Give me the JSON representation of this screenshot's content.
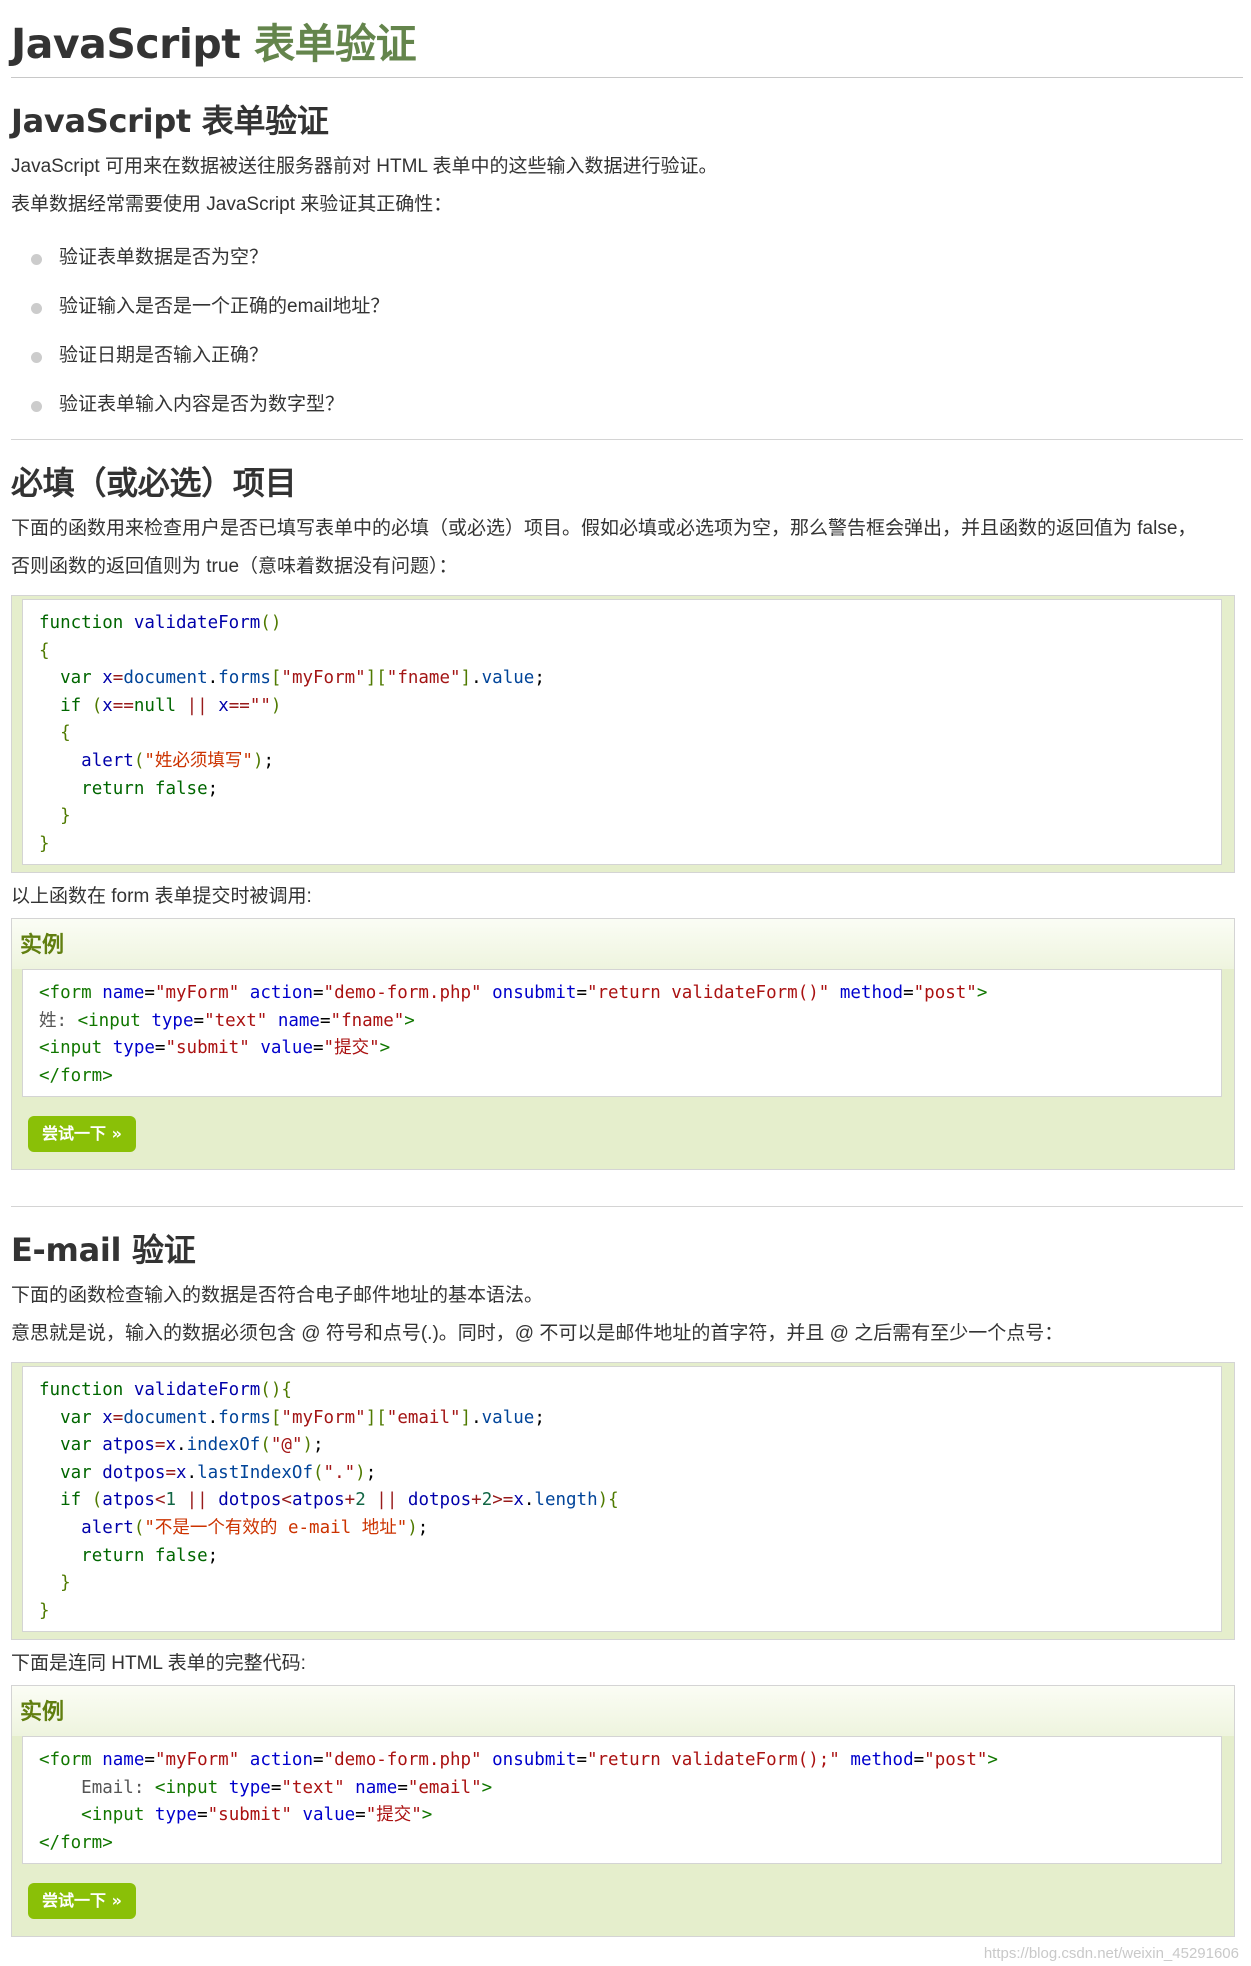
{
  "page": {
    "title_part1": "JavaScript",
    "title_part2": "表单验证",
    "watermark": "https://blog.csdn.net/weixin_45291606"
  },
  "section1": {
    "heading": "JavaScript 表单验证",
    "para1": "JavaScript 可用来在数据被送往服务器前对 HTML 表单中的这些输入数据进行验证。",
    "para2": "表单数据经常需要使用 JavaScript 来验证其正确性：",
    "bullets": [
      "验证表单数据是否为空？",
      "验证输入是否是一个正确的email地址？",
      "验证日期是否输入正确？",
      "验证表单输入内容是否为数字型？"
    ]
  },
  "section2": {
    "heading": "必填（或必选）项目",
    "para1": "下面的函数用来检查用户是否已填写表单中的必填（或必选）项目。假如必填或必选项为空，那么警告框会弹出，并且函数的返回值为 false，",
    "para2": "否则函数的返回值则为 true（意味着数据没有问题）：",
    "after_code": "以上函数在 form 表单提交时被调用:",
    "example_title": "实例",
    "try_button": "尝试一下 »"
  },
  "section3": {
    "heading": "E-mail 验证",
    "para1": "下面的函数检查输入的数据是否符合电子邮件地址的基本语法。",
    "para2": "意思就是说，输入的数据必须包含 @ 符号和点号(.)。同时，@ 不可以是邮件地址的首字符，并且 @ 之后需有至少一个点号：",
    "after_code": "下面是连同 HTML 表单的完整代码:",
    "example_title": "实例",
    "try_button": "尝试一下 »"
  },
  "colors": {
    "title_accent": "#64854c",
    "code_bg": "#e5eecc",
    "example_title": "#617f10",
    "button_bg": "#8ac007"
  }
}
